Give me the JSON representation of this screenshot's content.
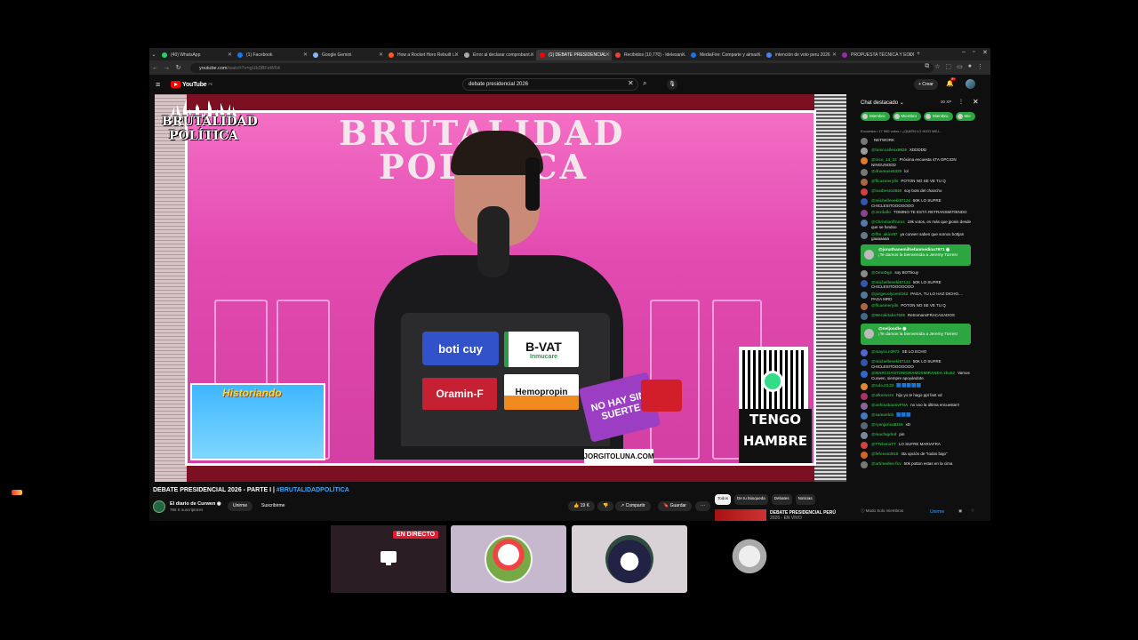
{
  "tabs": [
    {
      "label": "(40) WhatsApp",
      "color": "#25d366",
      "active": false
    },
    {
      "label": "(1) Facebook",
      "color": "#1877f2",
      "active": false
    },
    {
      "label": "Google Gemini",
      "color": "#8ab4f8",
      "active": false
    },
    {
      "label": "How a Rocket Hero Rebuilt i...",
      "color": "#ff5a1f",
      "active": false
    },
    {
      "label": "Error al declarar comprobant...",
      "color": "#aaaaaa",
      "active": false
    },
    {
      "label": "(1) DEBATE PRESIDENCIAL",
      "color": "#ff0000",
      "active": true
    },
    {
      "label": "Recibidos (10,770) - ldelesan...",
      "color": "#ea4335",
      "active": false
    },
    {
      "label": "MediaFire: Comparte y almac...",
      "color": "#1a73e8",
      "active": false
    },
    {
      "label": "intención de voto peru 2026",
      "color": "#4285f4",
      "active": false
    },
    {
      "label": "PROPUESTA TÉCNICA Y ECON...",
      "color": "#9c27b0",
      "active": false
    }
  ],
  "address_bar": {
    "host": "youtube.com",
    "path": "/watch?v=gUb3BFeW64"
  },
  "youtube": {
    "logo_text": "YouTube",
    "logo_country": "PE",
    "search_value": "debate presidencial 2026",
    "create_label": "+ Crear",
    "notification_count": "9+"
  },
  "video": {
    "sign_line1": "BRUTALIDAD",
    "sign_line2": "POLÍTICA",
    "corner_logo_line1": "BRUTALIDAD",
    "corner_logo_line2": "POLÍTICA",
    "stickers": {
      "boticuy": "boti cuy",
      "bvat": "B-VAT",
      "bvat_sub": "Inmucare",
      "oramin": "Oramin-F",
      "hemopropin": "Hemopropin",
      "no_hay": "NO HAY SIN SUERTE",
      "jorgito": "JORGITOLUNA.COM"
    },
    "historiando": "Historiando",
    "tengo_hambre_1": "TENGO",
    "tengo_hambre_2": "HAMBRE"
  },
  "title_main": "DEBATE PRESIDENCIAL 2026 - PARTE I | ",
  "title_hashtag": "#BRUTALIDADPOLÍTICA",
  "channel": {
    "name": "El diario de Curwen ◉",
    "subscribers": "765 K suscriptores",
    "join_label": "Unirme",
    "subscribe_label": "Suscribirme"
  },
  "actions": {
    "likes": "19 K",
    "share": "Compartir",
    "save": "Guardar",
    "more": "···"
  },
  "related_chips": [
    "Todos",
    "De tu búsqueda",
    "Debates",
    "Noticias"
  ],
  "related_video": {
    "title": "DEBATE PRESIDENCIAL PERÚ",
    "subtitle": "2026 - EN VIVO"
  },
  "chat": {
    "header": "Chat destacado ⌄",
    "points": "30 XP",
    "member_pills": [
      "Miembro",
      "Miembro",
      "Miembro",
      "Mie"
    ],
    "pinned": "Encuesta • 17 990 votos • ¿QUIEN LO HIZO MEJ...",
    "messages": [
      {
        "author": "",
        "text": "NETWORK",
        "color": "#777777"
      },
      {
        "author": "@luisccalleux9829",
        "text": "XDDDDD",
        "color": "#9b9b9b"
      },
      {
        "author": "@nico_14_22",
        "text": "Próxima encuesta 4TA OPCION NINGUNODD",
        "color": "#e07a2a"
      },
      {
        "author": "@dnamuss5325",
        "text": "lol",
        "color": "#777777"
      },
      {
        "author": "@flcasmeryils",
        "text": "POTON NO SE VE TU Q",
        "color": "#aa6644"
      },
      {
        "author": "@icadtesto2840",
        "text": "soy bots del chancho",
        "color": "#d04040"
      },
      {
        "author": "@michelleneki87124",
        "text": "50K LO SUFRE CHICLESITOOOOOOO",
        "color": "#3355aa"
      },
      {
        "author": "@Jordallo",
        "text": "TOMINO TE ESTÁ RETRANSMITIENDO",
        "color": "#884488"
      },
      {
        "author": "@Christianflrurez",
        "text": "19k votos, es más que jposis desde que se fundoo",
        "color": "#5577aa"
      },
      {
        "author": "@fhe_akinr97",
        "text": "ya curwen sabes que somos bottjan gaaaaaaa",
        "color": "#667788"
      }
    ],
    "welcome1": {
      "author": "@jonathanemilhefanmedina7971 ◉",
      "text": "¡Te damos la bienvenida a Jeremy Torres!"
    },
    "messages2": [
      {
        "author": "@OmoDgn",
        "text": "soy BOTticuy",
        "color": "#8a8a8a"
      },
      {
        "author": "@michelleneki87124",
        "text": "50K LO SUFRE CHICLESITOOOOOOO",
        "color": "#3355aa"
      },
      {
        "author": "@jorgecolycent162",
        "text": "PAGA, TU LO HAZ DICHO.... PAGA MRD",
        "color": "#557799"
      },
      {
        "author": "@flcasmeryils",
        "text": "POTON NO SE VE TU Q",
        "color": "#aa6644"
      },
      {
        "author": "@Merakitabs7608",
        "text": "RetromansFRACASADOS",
        "color": "#446688"
      }
    ],
    "welcome2": {
      "author": "@neljoodle ◉",
      "text": "¡Te damos la bienvenida a Jeremy Torres!"
    },
    "messages3": [
      {
        "author": "@mayra.n3972",
        "text": "SE LO ECHO",
        "color": "#5566cc"
      },
      {
        "author": "@michelleneki87124",
        "text": "50K LO SUFRE CHICLESITOOOOOOO",
        "color": "#3355aa"
      },
      {
        "author": "@MARCOANTONIORAMOSMIRANDA-zku52",
        "text": "Vamos Curwen, siempre apoyándote.",
        "color": "#3366cc"
      },
      {
        "author": "@rulo.23.23",
        "text": "🟦🟦🟦🟦🟦",
        "color": "#dd8833"
      },
      {
        "author": "@alkonvcm",
        "text": "hijo yo te hago ppt fast xd",
        "color": "#aa3366"
      },
      {
        "author": "@anhisabaunvFNA",
        "text": "no voo la última encuesta!!!",
        "color": "#886699"
      },
      {
        "author": "@samuelcb",
        "text": "🟦🟦🟦",
        "color": "#4477bb"
      },
      {
        "author": "@ryanjarisa8315",
        "text": "xD",
        "color": "#556677"
      },
      {
        "author": "@macfagdnd",
        "text": "pin",
        "color": "#778899"
      },
      {
        "author": "@TTelemaTT",
        "text": "LO SUFRE MARIAFRA",
        "color": "#cc4444"
      },
      {
        "author": "@fefosso2016",
        "text": "4ta opción de \"todos bajo\"",
        "color": "#cc6622"
      },
      {
        "author": "@artimedes-fcv",
        "text": "50k potton estas en la cima",
        "color": "#777777"
      }
    ],
    "footer_mode": "Modo Solo miembros",
    "footer_join": "Unirme"
  },
  "meeting": {
    "live_badge": "EN DIRECTO"
  }
}
